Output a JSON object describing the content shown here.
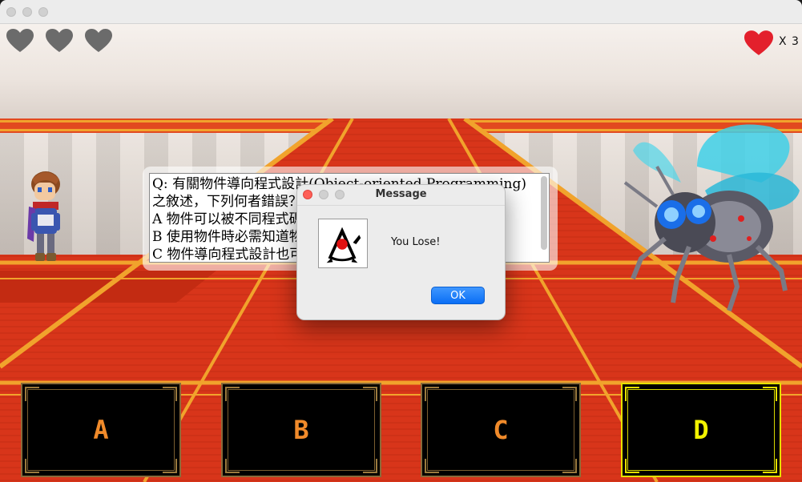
{
  "window": {
    "title": ""
  },
  "hud": {
    "player_hearts_remaining": 0,
    "player_hearts_total": 3,
    "enemy_lives_label": "X 3"
  },
  "question": {
    "text": "Q: 有關物件導向程式設計(Object-oriented Programming)之敘述，下列何者錯誤？\nA 物件可以被不同程式碼重複使用\nB 使用物件時必需知道物件內部的運作細節\nC 物件導向程式設計也可以提升程式碼的可維護性\nD 物件之間可以互相傳送訊息"
  },
  "dialog": {
    "title": "Message",
    "message": "You Lose!",
    "ok_label": "OK",
    "icon": "java-duke-icon"
  },
  "answers": [
    {
      "label": "A",
      "selected": false
    },
    {
      "label": "B",
      "selected": false
    },
    {
      "label": "C",
      "selected": false
    },
    {
      "label": "D",
      "selected": true
    }
  ],
  "colors": {
    "heart_empty": "#6b6b6b",
    "heart_full": "#e3202c",
    "answer_text": "#f08a2a",
    "answer_selected": "#f2f200",
    "ok_button": "#1a7cf7",
    "carpet": "#d8351a"
  }
}
